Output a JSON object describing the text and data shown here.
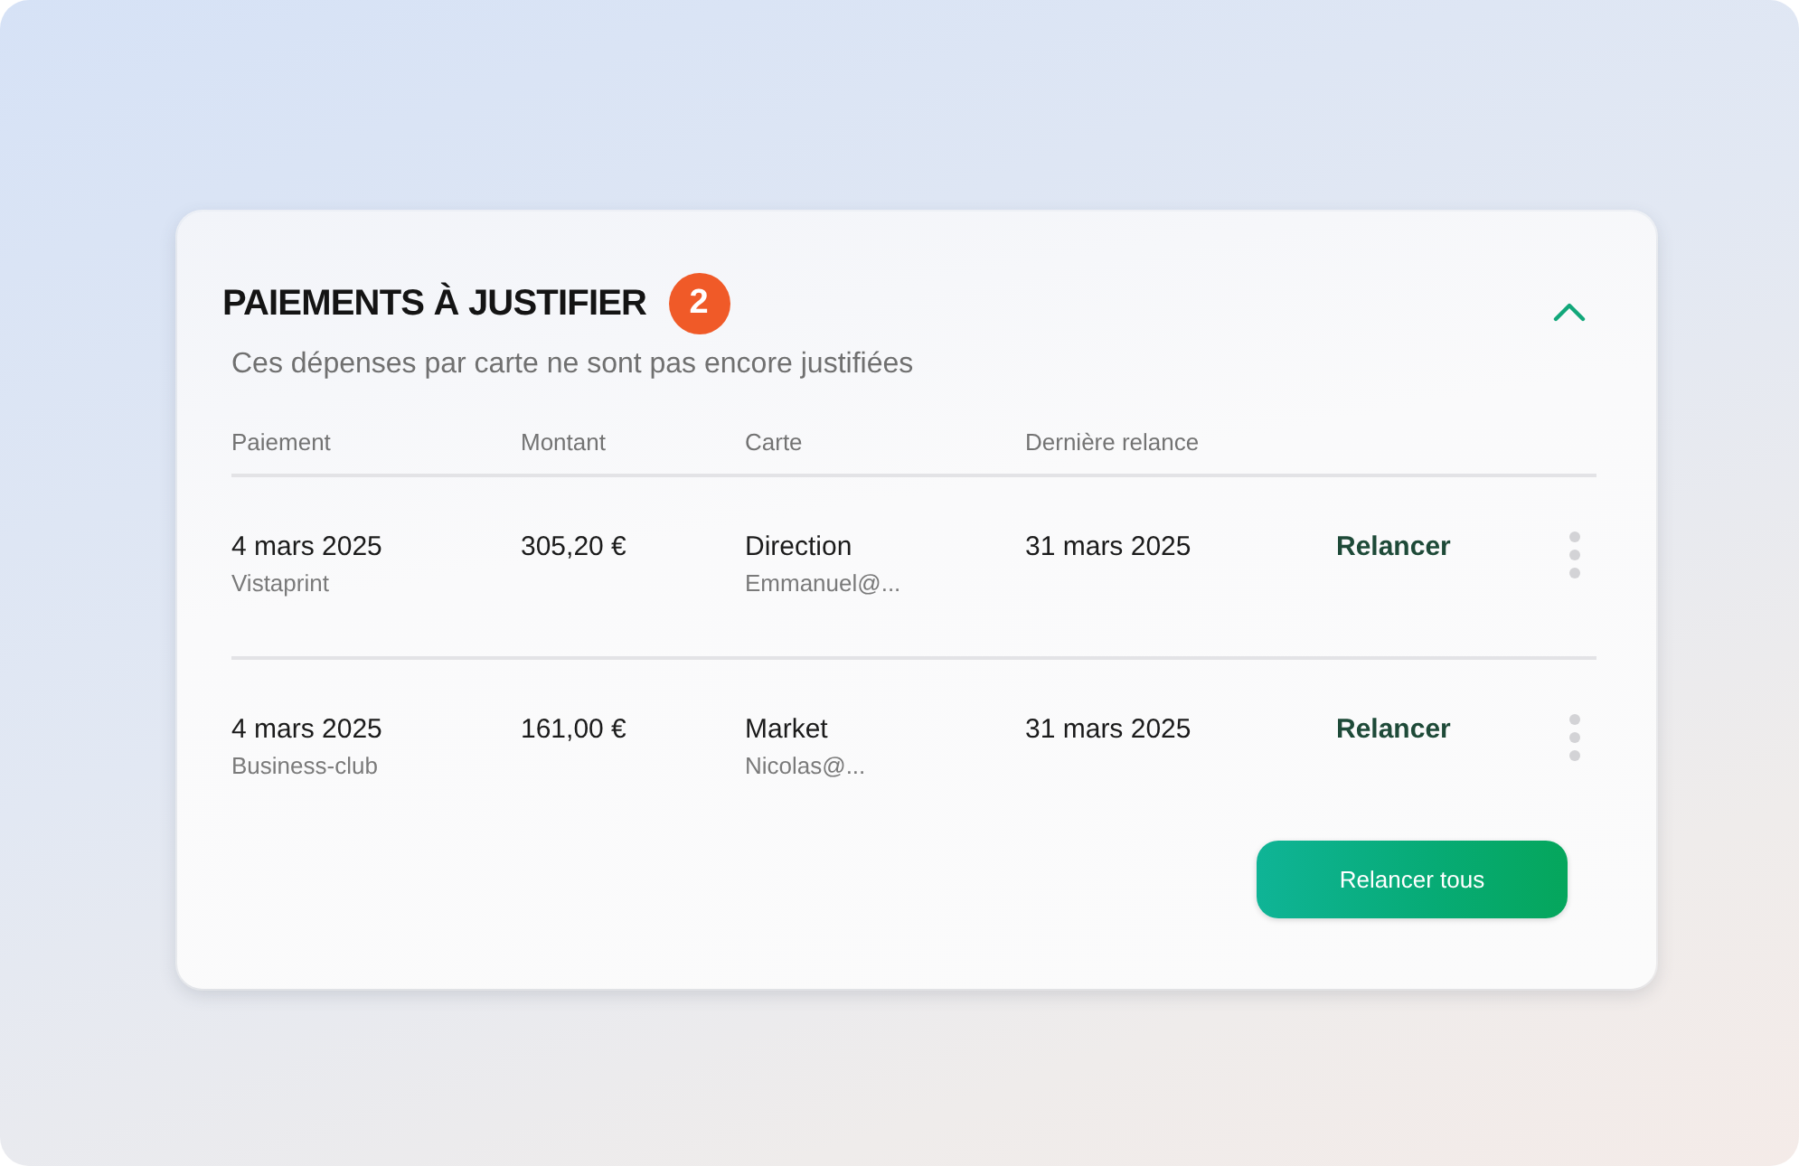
{
  "card": {
    "title": "PAIEMENTS À JUSTIFIER",
    "count": "2",
    "expanded": true,
    "subtitle": "Ces dépenses par carte ne sont pas encore justifiées",
    "table": {
      "columns": [
        "Paiement",
        "Montant",
        "Carte",
        "Dernière relance"
      ],
      "rows": [
        {
          "date": "4 mars 2025",
          "merchant": "Vistaprint",
          "amount": "305,20 €",
          "card": "Direction",
          "holder": "Emmanuel@...",
          "last_reminder": "31 mars 2025",
          "action": "Relancer"
        },
        {
          "date": "4 mars 2025",
          "merchant": "Business-club",
          "amount": "161,00 €",
          "card": "Market",
          "holder": "Nicolas@...",
          "last_reminder": "31 mars 2025",
          "action": "Relancer"
        }
      ]
    },
    "button": "Relancer tous"
  }
}
